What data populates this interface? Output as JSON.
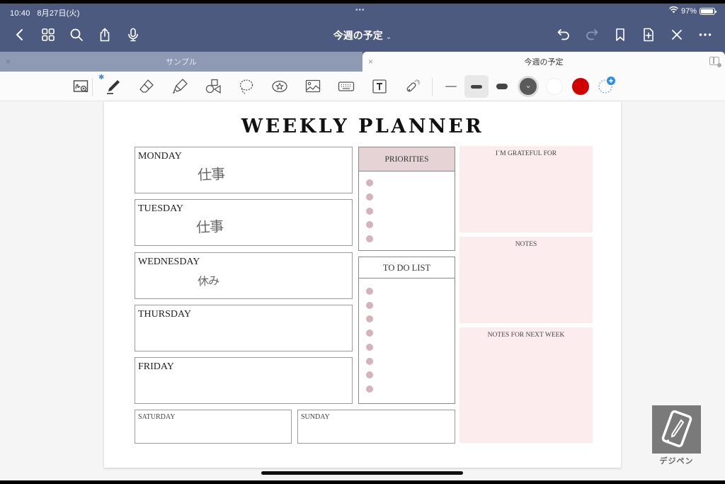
{
  "status_bar": {
    "time": "10:40",
    "date": "8月27日(火)",
    "multitask_dots": "•••",
    "battery_percent": "97%",
    "battery_level": 0.97
  },
  "navbar": {
    "document_title": "今週の予定",
    "title_chevron": "⌄",
    "left_icons": [
      "back-icon",
      "grid-icon",
      "search-icon",
      "share-icon",
      "microphone-icon"
    ],
    "right_icons": [
      "undo-icon",
      "redo-icon",
      "bookmark-icon",
      "add-page-icon",
      "close-icon",
      "more-icon"
    ]
  },
  "tabs": [
    {
      "label": "サンプル",
      "close": "×",
      "active": false
    },
    {
      "label": "今週の予定",
      "close": "×",
      "active": true
    }
  ],
  "toolbar": {
    "bluetooth_mark": "✱",
    "tools": [
      "zoom-window-tool",
      "pen-tool",
      "eraser-tool",
      "highlighter-tool",
      "shapes-tool",
      "lasso-tool",
      "elements-tool",
      "image-tool",
      "keyboard-tool",
      "text-tool",
      "laser-pointer-tool"
    ],
    "stroke_widths": [
      "thin",
      "medium",
      "thick"
    ],
    "selected_stroke": "medium",
    "colors": [
      {
        "name": "dark-gray",
        "hex": "#5a5a5a",
        "selected": true
      },
      {
        "name": "white",
        "hex": "#ffffff",
        "selected": false
      },
      {
        "name": "red",
        "hex": "#d10000",
        "selected": false
      }
    ],
    "add_color_accent": "#2d8cf0"
  },
  "planner": {
    "title": "WEEKLY PLANNER",
    "days": [
      {
        "label": "MONDAY",
        "note": "仕事"
      },
      {
        "label": "TUESDAY",
        "note": "仕事"
      },
      {
        "label": "WEDNESDAY",
        "note": "休み"
      },
      {
        "label": "THURSDAY",
        "note": ""
      },
      {
        "label": "FRIDAY",
        "note": ""
      }
    ],
    "weekend": [
      {
        "label": "SATURDAY"
      },
      {
        "label": "SUNDAY"
      }
    ],
    "priorities": {
      "header": "PRIORITIES",
      "bullet_count": 5
    },
    "todo": {
      "header": "TO DO LIST",
      "bullet_count": 8
    },
    "notes": [
      {
        "label": "I´M GRATEFUL FOR"
      },
      {
        "label": "NOTES"
      },
      {
        "label": "NOTES FOR NEXT WEEK"
      }
    ],
    "accent_pink": "#fdeced",
    "header_pink": "#e6d3d6",
    "bullet_color": "#d4b3ba"
  },
  "watermark": {
    "text": "デジペン"
  }
}
